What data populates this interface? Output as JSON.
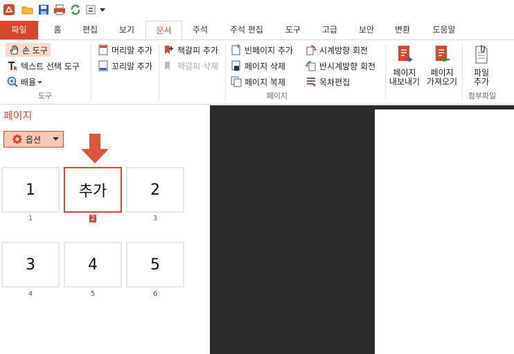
{
  "tabs": {
    "file": "파일",
    "items": [
      "홈",
      "편집",
      "보기",
      "문서",
      "주석",
      "주석 편집",
      "도구",
      "고급",
      "보안",
      "변환",
      "도움말"
    ],
    "active": "문서"
  },
  "ribbon": {
    "tools": {
      "hand_tool": "손 도구",
      "text_select": "텍스트 선택 도구",
      "zoom": "배율",
      "group_label": "도구"
    },
    "header_footer": {
      "header_add": "머리말 추가",
      "footer_add": "꼬리말 추가"
    },
    "bookmark": {
      "add": "책갈피 추가",
      "delete": "책갈피 삭제"
    },
    "page": {
      "blank_add": "빈페이지 추가",
      "delete": "페이지 삭제",
      "duplicate": "페이지 복제",
      "group_label": "페이지"
    },
    "rotate": {
      "clockwise": "시계방향 회전",
      "counter": "반시계방향 회전",
      "toc_edit": "목차편집"
    },
    "export": {
      "line1": "페이지",
      "line2": "내보내기"
    },
    "import": {
      "line1": "페이지",
      "line2": "가져오기"
    },
    "attach": {
      "line1": "파일",
      "line2": "추가",
      "group_label": "첨부파일"
    }
  },
  "panel": {
    "title": "페이지",
    "options_label": "옵션",
    "thumbnails": [
      {
        "label": "1",
        "number": "1"
      },
      {
        "label": "추가",
        "number": "2"
      },
      {
        "label": "2",
        "number": "3"
      },
      {
        "label": "3",
        "number": "4"
      },
      {
        "label": "4",
        "number": "5"
      },
      {
        "label": "5",
        "number": "6"
      }
    ]
  },
  "colors": {
    "accent": "#d9472b",
    "doc_background": "#2b2b2b"
  }
}
